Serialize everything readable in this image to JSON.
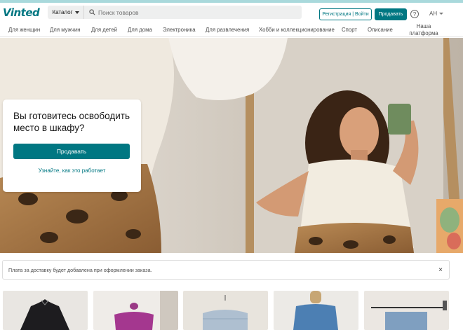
{
  "header": {
    "logo": "Vinted",
    "catalog_label": "Каталог",
    "search_placeholder": "Поиск товаров",
    "register_label": "Регистрация | Войти",
    "sell_label": "Продавать",
    "help_label": "?",
    "language": "AH"
  },
  "categories": [
    "Для женщин",
    "Для мужчин",
    "Для детей",
    "Для дома",
    "Электроника",
    "Для развлечения",
    "Хобби и коллекционирование",
    "Спорт",
    "Описание",
    "Наша платформа"
  ],
  "hero": {
    "title": "Вы готовитесь освободить место в шкафу?",
    "cta_label": "Продавать",
    "howto_link": "Узнайте, как это работает"
  },
  "notice": {
    "text": "Плата за доставку будет добавлена при оформлении заказа.",
    "close_label": "×"
  },
  "items": [
    {
      "name": "black-coat"
    },
    {
      "name": "purple-top"
    },
    {
      "name": "light-blue-sweater"
    },
    {
      "name": "blue-knit-vest"
    },
    {
      "name": "denim-on-rack"
    }
  ],
  "colors": {
    "brand": "#007782",
    "top_strip": "#a9d9dc"
  }
}
